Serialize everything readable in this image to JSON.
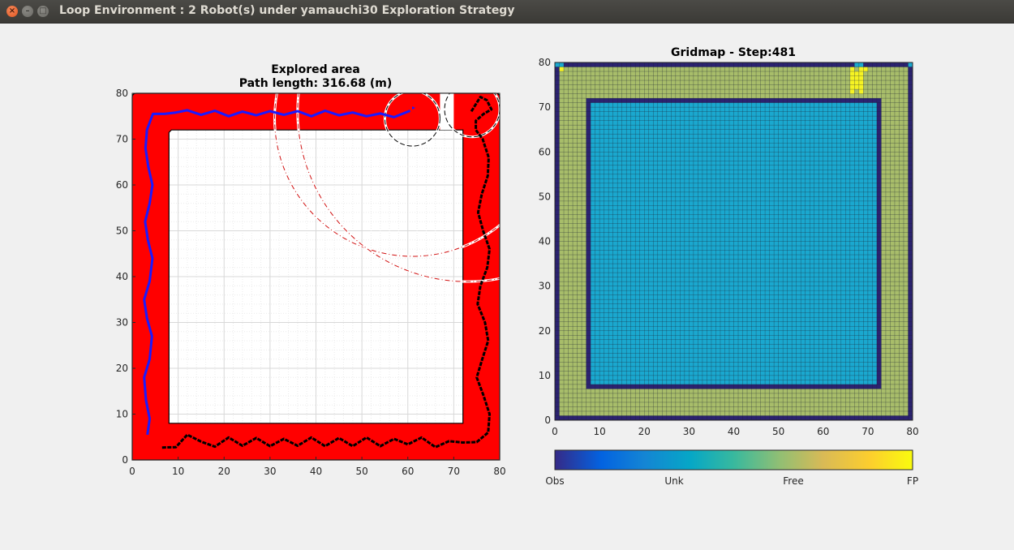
{
  "window": {
    "title": "Loop Environment : 2 Robot(s) under yamauchi30 Exploration Strategy",
    "close_glyph": "×",
    "minimize_glyph": "–",
    "maximize_glyph": "□"
  },
  "left_plot": {
    "title_line1": "Explored area",
    "title_line2": "Path length: 316.68 (m)",
    "colors": {
      "explored": "#ff0000",
      "robot1_path": "#1a1aff",
      "robot2_path": "#000000",
      "sensor_arc": "#d01010"
    }
  },
  "right_plot": {
    "title": "Gridmap - Step:481",
    "colorbar_labels": [
      "Obs",
      "Unk",
      "Free",
      "FP"
    ],
    "colors": {
      "obs": "#2b2270",
      "unk": "#1aa8cf",
      "free": "#a8bd6a",
      "fp": "#f6f323"
    }
  },
  "chart_data": [
    {
      "type": "line",
      "title": "Explored area\nPath length: 316.68 (m)",
      "xlim": [
        0,
        80
      ],
      "ylim": [
        0,
        80
      ],
      "xticks": [
        0,
        10,
        20,
        30,
        40,
        50,
        60,
        70,
        80
      ],
      "yticks": [
        0,
        10,
        20,
        30,
        40,
        50,
        60,
        70,
        80
      ],
      "grid": true,
      "outer_bounds": [
        0,
        80,
        0,
        80
      ],
      "inner_hole": [
        8,
        72,
        8,
        72
      ],
      "series": [
        {
          "x": [
            3.3,
            3.8,
            3.0,
            2.6,
            3.8,
            4.3,
            3.2,
            2.6,
            3.8,
            4.4,
            3.4,
            2.8,
            3.8,
            4.4,
            3.5,
            2.9,
            3.2,
            4.5,
            7,
            9.5,
            12,
            15,
            18,
            21,
            24,
            27,
            30,
            33,
            36,
            39,
            42,
            45,
            48,
            51,
            54,
            57,
            60.5
          ],
          "y": [
            5.5,
            9,
            13,
            18,
            22,
            27,
            31,
            35,
            39,
            44,
            48,
            52,
            56,
            60,
            64,
            68,
            72,
            75.5,
            75.5,
            75.8,
            76.3,
            75.3,
            76.2,
            75,
            76,
            75.2,
            76.1,
            75.3,
            76.1,
            75,
            76.2,
            75.2,
            75.8,
            75,
            75.6,
            74.8,
            76.2
          ]
        },
        {
          "x": [
            6.5,
            9.5,
            12,
            15,
            18,
            21,
            24,
            27,
            30,
            33,
            36,
            39,
            42,
            45,
            48,
            51,
            54,
            57,
            60,
            63,
            66,
            69,
            72,
            75,
            77.5,
            77.8,
            76.5,
            75,
            76.2,
            77.5,
            76.8,
            75.2,
            75.8,
            77.3,
            77.8,
            76.4,
            75.3,
            76.1,
            77.4,
            77.6,
            76.3,
            74.8,
            74.8,
            76.5,
            78.2,
            77.2,
            75.8,
            73.8
          ],
          "y": [
            2.7,
            2.8,
            5.5,
            4.0,
            2.9,
            4.9,
            3.1,
            4.8,
            3.0,
            4.6,
            3.1,
            4.9,
            3.0,
            4.8,
            3.0,
            4.9,
            3.0,
            4.6,
            3.4,
            4.9,
            2.8,
            4.1,
            3.8,
            3.9,
            6,
            10,
            14,
            18,
            22,
            26,
            30,
            34,
            38,
            42,
            46,
            50,
            54,
            58,
            62,
            66,
            70,
            72,
            74,
            75.5,
            76.5,
            78.5,
            79.2,
            76
          ]
        }
      ]
    },
    {
      "type": "heatmap",
      "title": "Gridmap - Step:481",
      "xlim": [
        0,
        80
      ],
      "ylim": [
        0,
        80
      ],
      "xticks": [
        0,
        10,
        20,
        30,
        40,
        50,
        60,
        70,
        80
      ],
      "yticks": [
        0,
        10,
        20,
        30,
        40,
        50,
        60,
        70,
        80
      ],
      "cell_size": 1,
      "default_class": "unk",
      "regions": [
        {
          "class": "free",
          "x": [
            1,
            79
          ],
          "y": [
            1,
            79
          ]
        },
        {
          "class": "obs",
          "x": [
            7,
            73
          ],
          "y": [
            7,
            72
          ]
        },
        {
          "class": "unk",
          "x": [
            8,
            72
          ],
          "y": [
            8,
            71
          ]
        }
      ],
      "cells": [
        {
          "class": "obs",
          "x": [
            0,
            80
          ],
          "y": [
            0,
            1
          ]
        },
        {
          "class": "obs",
          "x": [
            0,
            80
          ],
          "y": [
            79,
            80
          ]
        },
        {
          "class": "obs",
          "x": [
            0,
            1
          ],
          "y": [
            0,
            80
          ]
        },
        {
          "class": "obs",
          "x": [
            79,
            80
          ],
          "y": [
            0,
            80
          ]
        },
        {
          "class": "unk",
          "x": [
            0,
            2
          ],
          "y": [
            79,
            80
          ]
        },
        {
          "class": "unk",
          "x": [
            67,
            69
          ],
          "y": [
            79,
            80
          ]
        },
        {
          "class": "unk",
          "x": [
            79,
            80
          ],
          "y": [
            79,
            80
          ]
        },
        {
          "class": "fp",
          "x": [
            1,
            2
          ],
          "y": [
            78,
            79
          ]
        },
        {
          "class": "fp",
          "x": [
            66,
            67
          ],
          "y": [
            73,
            79
          ]
        },
        {
          "class": "fp",
          "x": [
            67,
            68
          ],
          "y": [
            74,
            78
          ]
        },
        {
          "class": "fp",
          "x": [
            68,
            69
          ],
          "y": [
            73,
            79
          ]
        },
        {
          "class": "fp",
          "x": [
            69,
            70
          ],
          "y": [
            78,
            79
          ]
        }
      ],
      "colorbar": {
        "labels": [
          "Obs",
          "Unk",
          "Free",
          "FP"
        ]
      }
    }
  ]
}
